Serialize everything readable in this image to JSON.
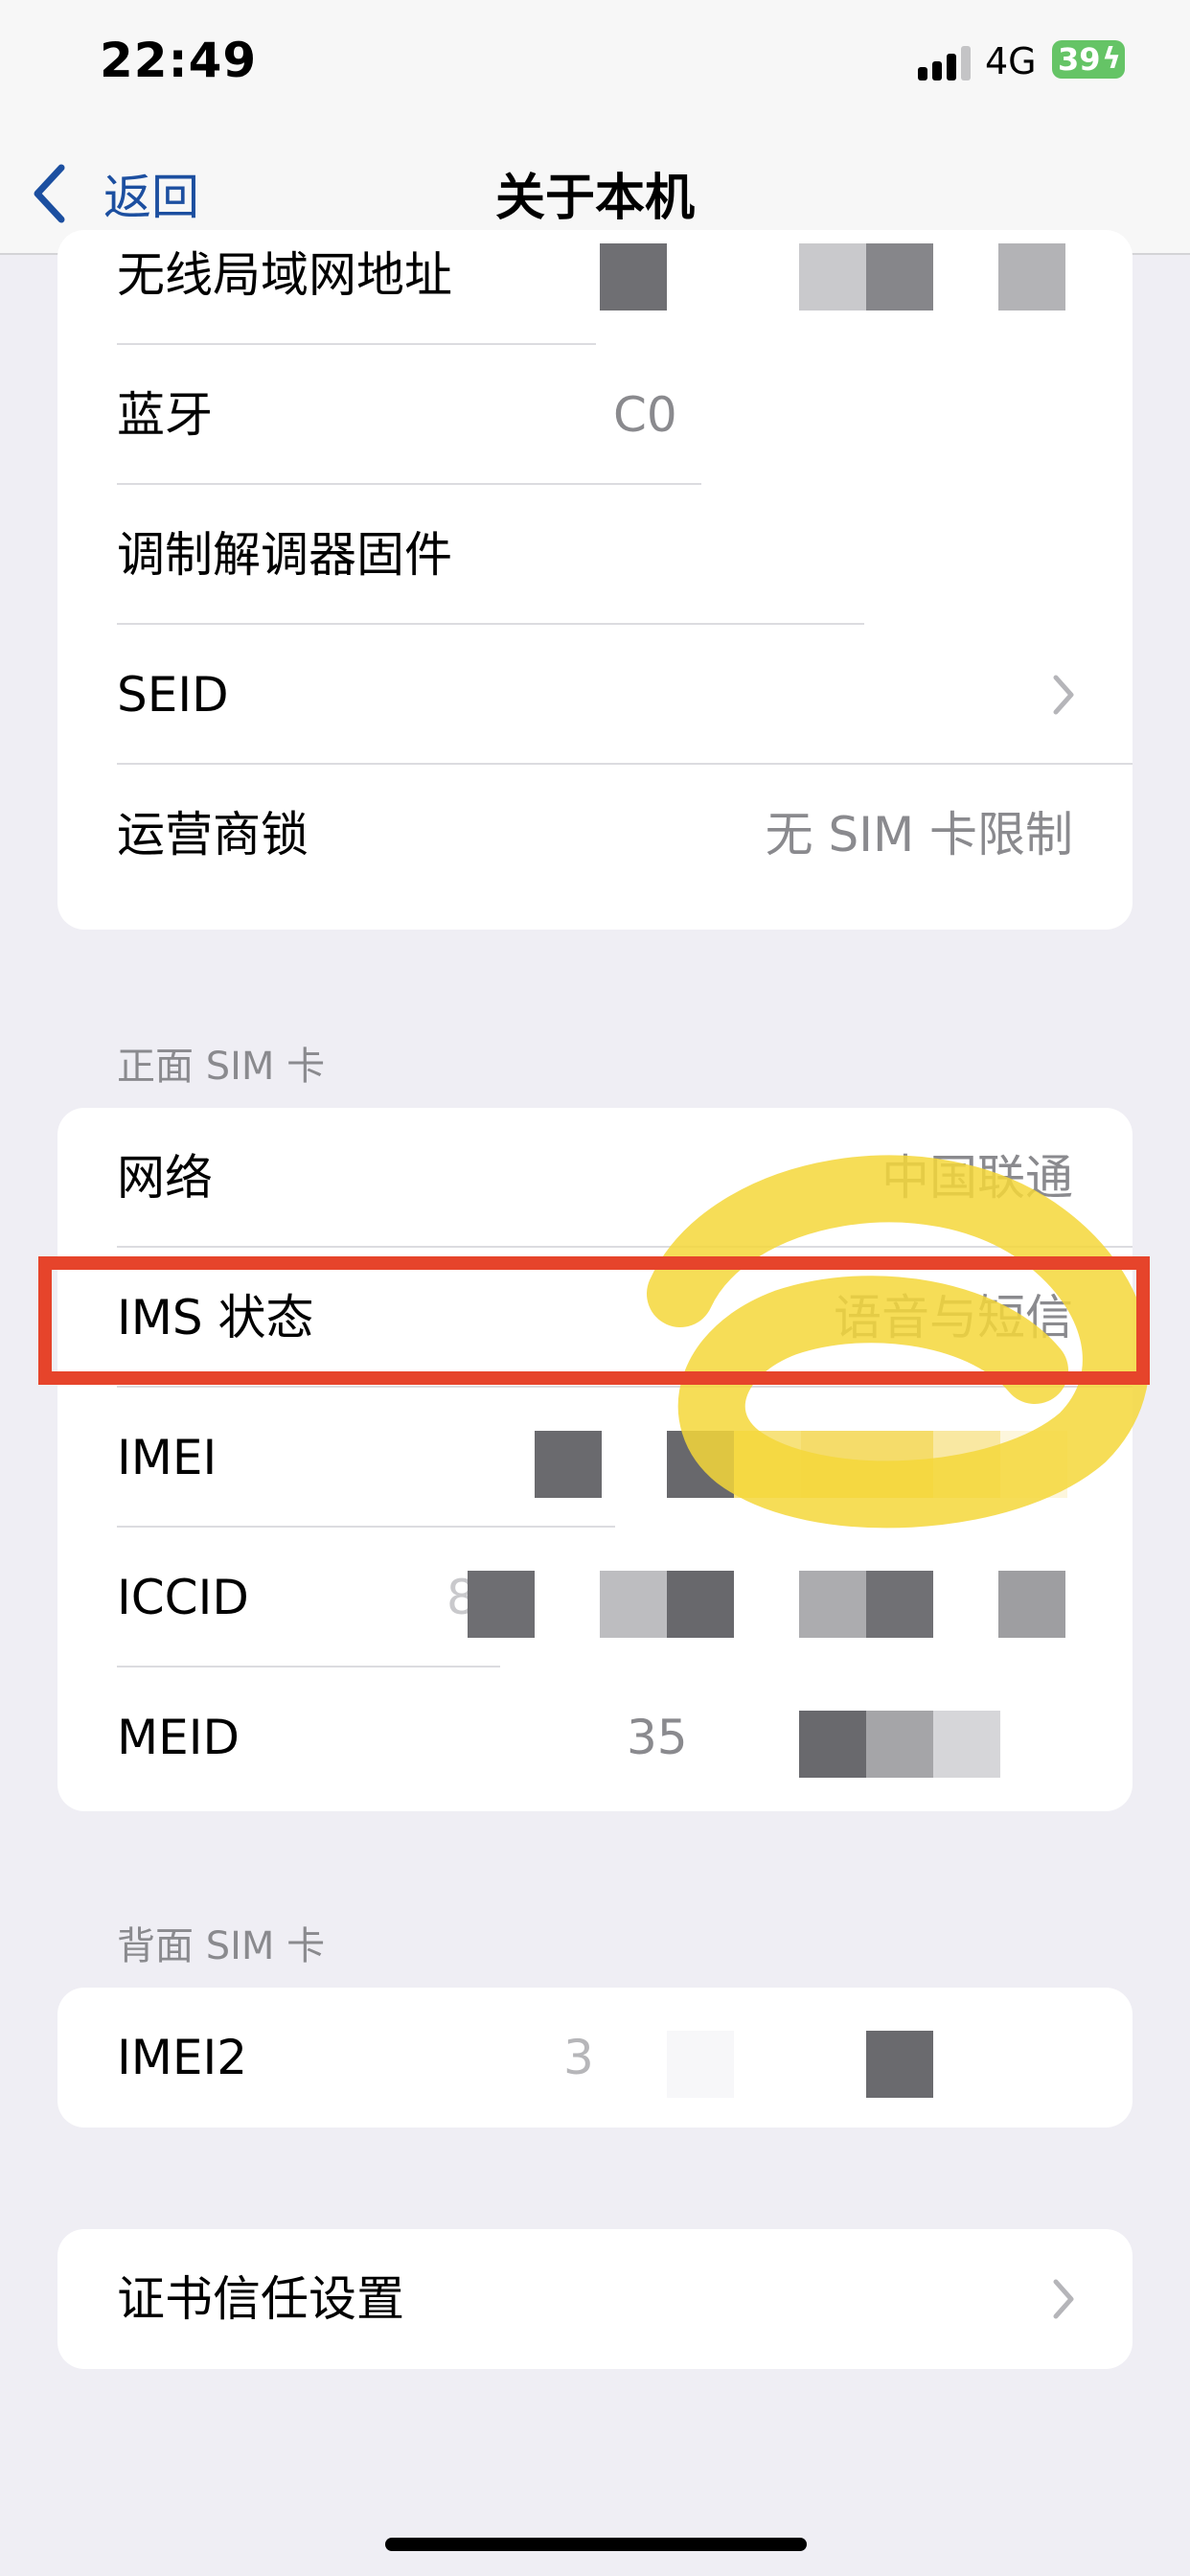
{
  "status_bar": {
    "time": "22:49",
    "network": "4G",
    "battery": "39"
  },
  "nav": {
    "back_label": "返回",
    "title": "关于本机"
  },
  "group1": {
    "rows": [
      {
        "label": "无线局域网地址"
      },
      {
        "label": "蓝牙",
        "partial_value": "C0"
      },
      {
        "label": "调制解调器固件"
      },
      {
        "label": "SEID"
      },
      {
        "label": "运营商锁",
        "value": "无 SIM 卡限制"
      }
    ]
  },
  "front_sim": {
    "header": "正面 SIM 卡",
    "rows": [
      {
        "label": "网络",
        "value": "中国联通"
      },
      {
        "label": "IMS 状态",
        "value": "语音与短信"
      },
      {
        "label": "IMEI"
      },
      {
        "label": "ICCID",
        "partial_value": "8"
      },
      {
        "label": "MEID",
        "partial_value": "35"
      }
    ]
  },
  "back_sim": {
    "header": "背面 SIM 卡",
    "rows": [
      {
        "label": "IMEI2",
        "partial_value": "3"
      }
    ]
  },
  "cert": {
    "label": "证书信任设置"
  },
  "colors": {
    "accent": "#1c4fa0",
    "highlight": "#e6442b",
    "scribble": "#f5d73a",
    "battery": "#65c466"
  },
  "icons": {
    "back": "chevron-left-icon",
    "disclosure": "chevron-right-icon",
    "signal": "signal-bars-icon",
    "battery": "battery-charging-icon"
  }
}
